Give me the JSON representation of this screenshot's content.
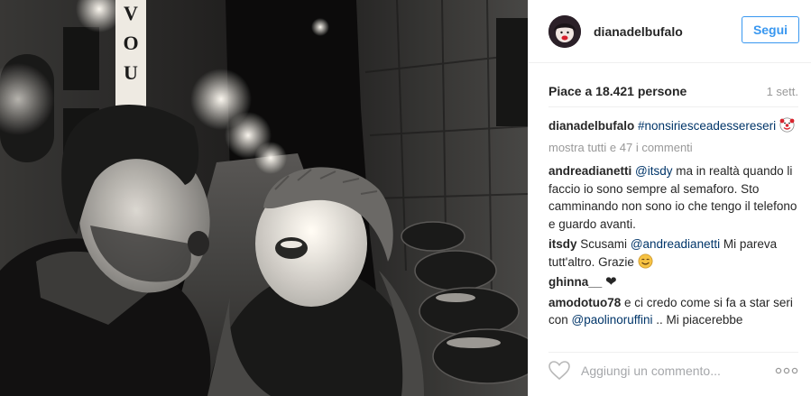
{
  "post": {
    "owner": "diana​delbufalo",
    "follow_label": "Segui",
    "likes_text": "Piace a 18.421 persone",
    "age": "1 sett.",
    "caption": {
      "user": "dianadelbufalo",
      "hashtag": "#nonsiriesceadessereseri",
      "emoji": "clown-emoji"
    },
    "show_all_comments": "mostra tutti e 47 i commenti",
    "comments": [
      {
        "user": "andreadianetti",
        "mention": "@itsdy",
        "text": " ma in realtà quando li faccio io sono sempre al semaforo. Sto camminando non sono io che tengo il telefono e guardo avanti."
      },
      {
        "user": "itsdy",
        "text": "Scusami ",
        "mention": "@andreadianetti",
        "text2": " Mi pareva tutt'altro. Grazie",
        "emoji": "smile-emoji"
      },
      {
        "user": "ghinna__",
        "icon": "heart-icon"
      },
      {
        "user": "amodotuo78",
        "text": "e ci credo come si fa a star seri con ",
        "mention": "@paolinoruffini",
        "text2": " .. Mi piacerebbe"
      }
    ],
    "add_comment_placeholder": "Aggiungi un commento...",
    "more_options_label": "ooo"
  },
  "photo": {
    "sign_letters": "VOU",
    "icons": [
      "heart-outline-icon",
      "more-dots-icon"
    ],
    "colors": {
      "accent": "#3897f0",
      "mention": "#003569",
      "muted": "#999999",
      "placeholder": "#a5a7aa"
    }
  }
}
